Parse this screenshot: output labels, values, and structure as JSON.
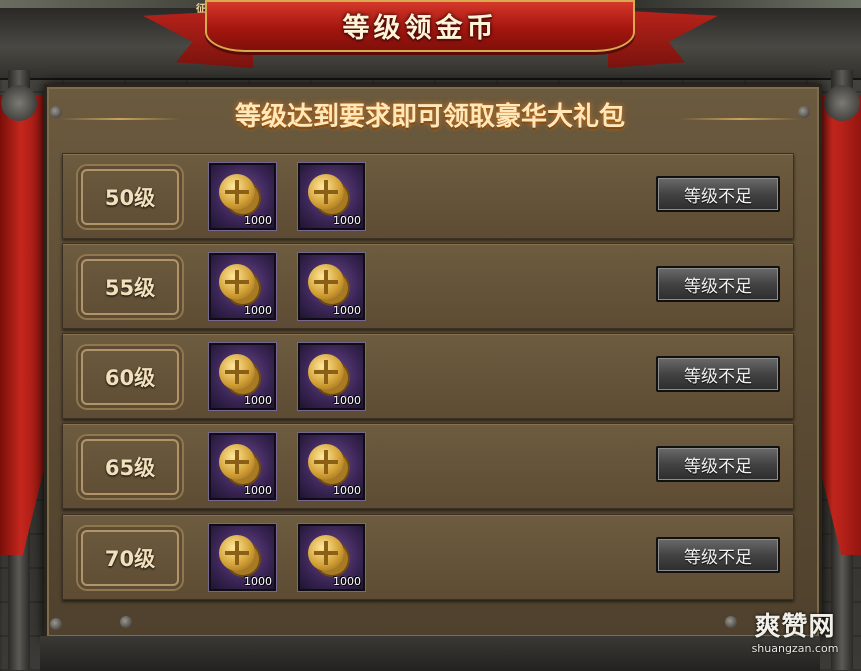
{
  "window": {
    "title": "等级领金币",
    "top_text": "征兵"
  },
  "header": {
    "subtitle": "等级达到要求即可领取豪华大礼包"
  },
  "rows": [
    {
      "level": "50级",
      "rewards": [
        {
          "icon": "gold-coin-icon",
          "qty": "1000"
        },
        {
          "icon": "gold-coin-icon",
          "qty": "1000"
        }
      ],
      "button": "等级不足"
    },
    {
      "level": "55级",
      "rewards": [
        {
          "icon": "gold-coin-icon",
          "qty": "1000"
        },
        {
          "icon": "gold-coin-icon",
          "qty": "1000"
        }
      ],
      "button": "等级不足"
    },
    {
      "level": "60级",
      "rewards": [
        {
          "icon": "gold-coin-icon",
          "qty": "1000"
        },
        {
          "icon": "gold-coin-icon",
          "qty": "1000"
        }
      ],
      "button": "等级不足"
    },
    {
      "level": "65级",
      "rewards": [
        {
          "icon": "gold-coin-icon",
          "qty": "1000"
        },
        {
          "icon": "gold-coin-icon",
          "qty": "1000"
        }
      ],
      "button": "等级不足"
    },
    {
      "level": "70级",
      "rewards": [
        {
          "icon": "gold-coin-icon",
          "qty": "1000"
        },
        {
          "icon": "gold-coin-icon",
          "qty": "1000"
        }
      ],
      "button": "等级不足"
    }
  ],
  "watermark": {
    "main": "爽赞网",
    "sub": "shuangzan.com"
  },
  "colors": {
    "ribbon": "#b7231b",
    "parchment": "#5a4a33",
    "item_bg": "#3a2555",
    "coin": "#d3a136",
    "button": "#434343"
  }
}
